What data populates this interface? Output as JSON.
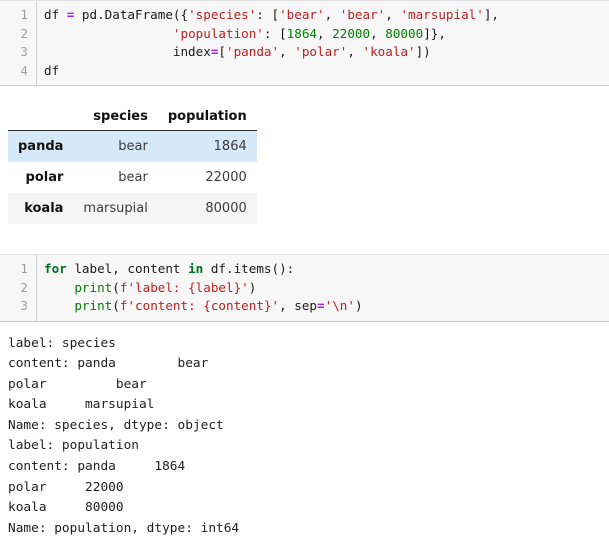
{
  "cell_1": {
    "line_numbers": [
      "1",
      "2",
      "3",
      "4"
    ],
    "lines": [
      {
        "tokens": [
          {
            "t": "plain",
            "s": "df "
          },
          {
            "t": "op",
            "s": "="
          },
          {
            "t": "plain",
            "s": " pd.DataFrame({"
          },
          {
            "t": "str",
            "s": "'species'"
          },
          {
            "t": "plain",
            "s": ": ["
          },
          {
            "t": "str",
            "s": "'bear'"
          },
          {
            "t": "plain",
            "s": ", "
          },
          {
            "t": "str",
            "s": "'bear'"
          },
          {
            "t": "plain",
            "s": ", "
          },
          {
            "t": "str",
            "s": "'marsupial'"
          },
          {
            "t": "plain",
            "s": "],"
          }
        ]
      },
      {
        "tokens": [
          {
            "t": "plain",
            "s": "                 "
          },
          {
            "t": "str",
            "s": "'population'"
          },
          {
            "t": "plain",
            "s": ": ["
          },
          {
            "t": "num",
            "s": "1864"
          },
          {
            "t": "plain",
            "s": ", "
          },
          {
            "t": "num",
            "s": "22000"
          },
          {
            "t": "plain",
            "s": ", "
          },
          {
            "t": "num",
            "s": "80000"
          },
          {
            "t": "plain",
            "s": "]},"
          }
        ]
      },
      {
        "tokens": [
          {
            "t": "plain",
            "s": "                 index"
          },
          {
            "t": "op",
            "s": "="
          },
          {
            "t": "plain",
            "s": "["
          },
          {
            "t": "str",
            "s": "'panda'"
          },
          {
            "t": "plain",
            "s": ", "
          },
          {
            "t": "str",
            "s": "'polar'"
          },
          {
            "t": "plain",
            "s": ", "
          },
          {
            "t": "str",
            "s": "'koala'"
          },
          {
            "t": "plain",
            "s": "])"
          }
        ]
      },
      {
        "tokens": [
          {
            "t": "plain",
            "s": "df"
          }
        ]
      }
    ]
  },
  "dataframe": {
    "index_header": "",
    "columns": [
      "species",
      "population"
    ],
    "index": [
      "panda",
      "polar",
      "koala"
    ],
    "rows": [
      {
        "index": "panda",
        "cells": [
          "bear",
          "1864"
        ],
        "style": "row-hl"
      },
      {
        "index": "polar",
        "cells": [
          "bear",
          "22000"
        ],
        "style": ""
      },
      {
        "index": "koala",
        "cells": [
          "marsupial",
          "80000"
        ],
        "style": "row-alt"
      }
    ],
    "highlight_color": "#d6e9f8",
    "alt_row_color": "#f5f5f5"
  },
  "cell_2": {
    "line_numbers": [
      "1",
      "2",
      "3"
    ],
    "lines": [
      {
        "tokens": [
          {
            "t": "kw",
            "s": "for"
          },
          {
            "t": "plain",
            "s": " label, content "
          },
          {
            "t": "kw",
            "s": "in"
          },
          {
            "t": "plain",
            "s": " df.items():"
          }
        ]
      },
      {
        "tokens": [
          {
            "t": "plain",
            "s": "    "
          },
          {
            "t": "fn",
            "s": "print"
          },
          {
            "t": "plain",
            "s": "("
          },
          {
            "t": "str",
            "s": "f'label: {label}'"
          },
          {
            "t": "plain",
            "s": ")"
          }
        ]
      },
      {
        "tokens": [
          {
            "t": "plain",
            "s": "    "
          },
          {
            "t": "fn",
            "s": "print"
          },
          {
            "t": "plain",
            "s": "("
          },
          {
            "t": "str",
            "s": "f'content: {content}'"
          },
          {
            "t": "plain",
            "s": ", sep"
          },
          {
            "t": "op",
            "s": "="
          },
          {
            "t": "str",
            "s": "'\\n'"
          },
          {
            "t": "plain",
            "s": ")"
          }
        ]
      }
    ]
  },
  "stdout": {
    "text": "label: species\ncontent: panda        bear\npolar         bear\nkoala     marsupial\nName: species, dtype: object\nlabel: population\ncontent: panda     1864\npolar     22000\nkoala     80000\nName: population, dtype: int64"
  }
}
